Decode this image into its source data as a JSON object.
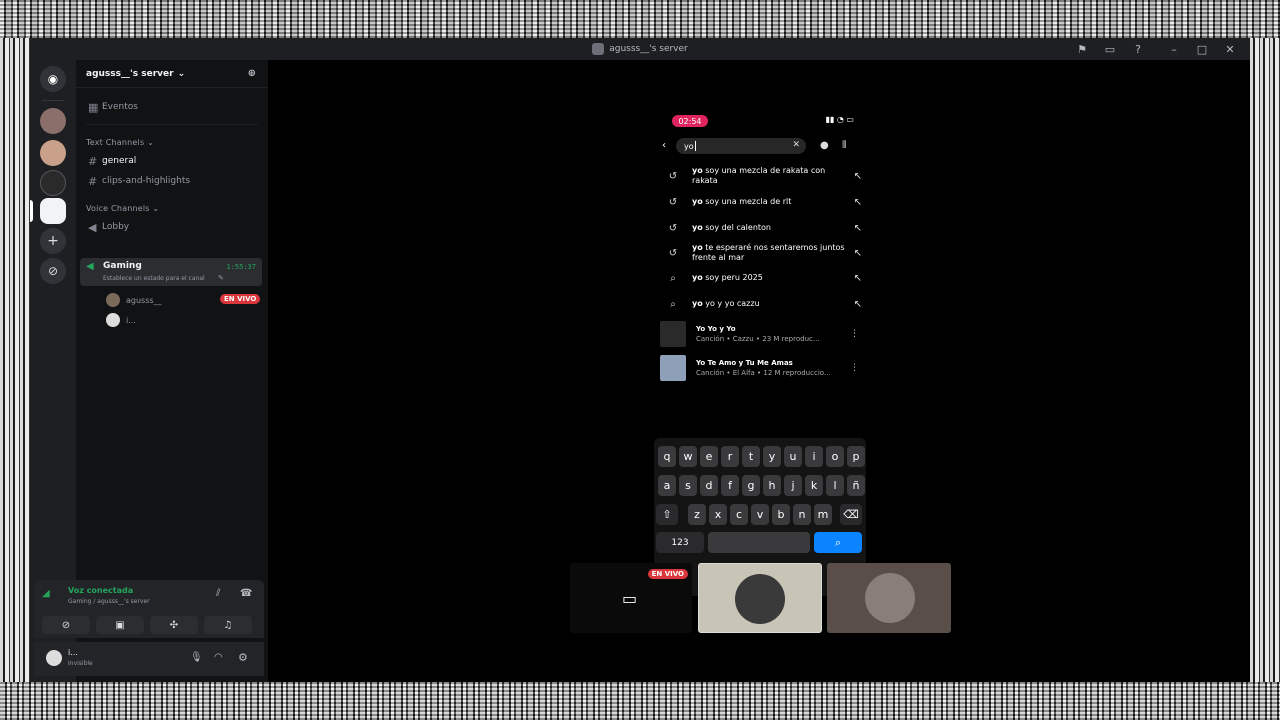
{
  "window": {
    "title": "agusss__'s server"
  },
  "server": {
    "name": "agusss__'s server",
    "events_label": "Eventos"
  },
  "text_channels": {
    "category": "Text Channels",
    "items": [
      "general",
      "clips-and-highlights"
    ]
  },
  "voice_channels": {
    "category": "Voice Channels",
    "items": [
      {
        "name": "Lobby"
      },
      {
        "name": "Gaming",
        "timer": "1:55:37",
        "status": "Establece un estado para el canal"
      }
    ],
    "members": [
      {
        "name": "agusss__",
        "badge": "EN VIVO"
      },
      {
        "name": "i..."
      }
    ]
  },
  "voice_panel": {
    "status": "Voz conectada",
    "location": "Gaming / agusss__'s server"
  },
  "user_panel": {
    "name": "i...",
    "status": "Invisible"
  },
  "phone": {
    "time": "02:54",
    "query": "yo",
    "suggestions": [
      {
        "icon": "history-icon",
        "bold": "yo",
        "rest": " soy una mezcla de rakata con rakata"
      },
      {
        "icon": "history-icon",
        "bold": "yo",
        "rest": " soy una mezcla de rlt"
      },
      {
        "icon": "history-icon",
        "bold": "yo",
        "rest": " soy del calenton"
      },
      {
        "icon": "history-icon",
        "bold": "yo",
        "rest": " te esperaré nos sentaremos juntos frente al mar"
      },
      {
        "icon": "search-icon",
        "bold": "yo",
        "rest": " soy peru 2025"
      },
      {
        "icon": "search-icon",
        "bold": "yo",
        "rest": " yo y yo cazzu"
      }
    ],
    "songs": [
      {
        "title": "Yo Yo y Yo",
        "sub": "Canción • Cazzu • 23 M reproduc..."
      },
      {
        "title": "Yo Te Amo y Tu Me Amas",
        "sub": "Canción • El Alfa • 12 M reproduccio..."
      }
    ],
    "keyboard": {
      "row1": [
        "q",
        "w",
        "e",
        "r",
        "t",
        "y",
        "u",
        "i",
        "o",
        "p"
      ],
      "row2": [
        "a",
        "s",
        "d",
        "f",
        "g",
        "h",
        "j",
        "k",
        "l",
        "ñ"
      ],
      "row3": [
        "z",
        "x",
        "c",
        "v",
        "b",
        "n",
        "m"
      ],
      "numbers_key": "123"
    }
  },
  "stream_tiles": {
    "live_badge": "EN VIVO"
  }
}
